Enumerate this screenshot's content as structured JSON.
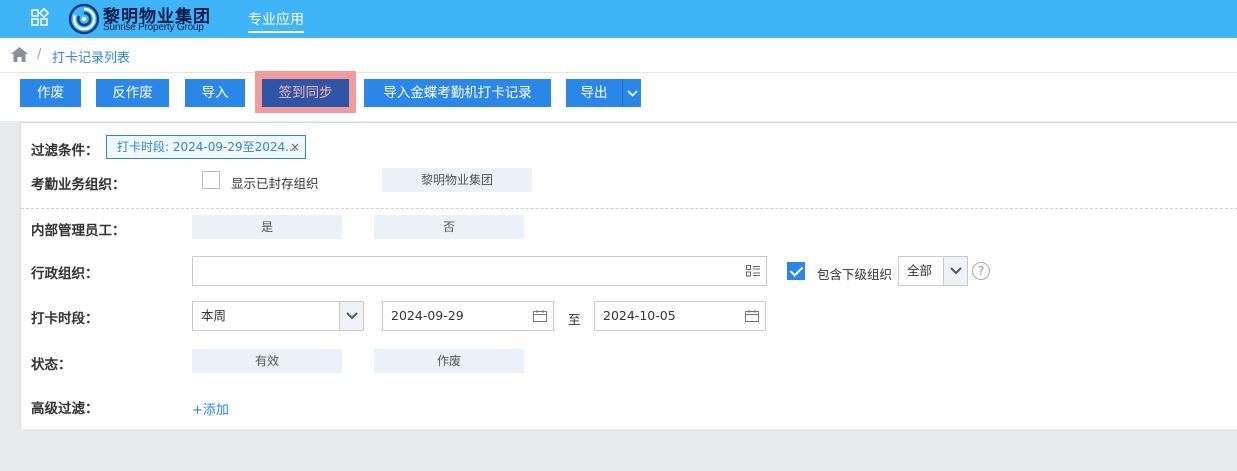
{
  "header": {
    "brand_cn": "黎明物业集团",
    "brand_en": "Sunrise Property Group",
    "nav_app": "专业应用",
    "accent": "#3fb4f7"
  },
  "breadcrumb": {
    "separator": "/",
    "current": "打卡记录列表"
  },
  "toolbar": {
    "void": "作废",
    "unvoid": "反作废",
    "import": "导入",
    "sync": "签到同步",
    "import_kingdee": "导入金蝶考勤机打卡记录",
    "export": "导出"
  },
  "filter": {
    "conditions_label": "过滤条件：",
    "active_tag": "打卡时段: 2024-09-29至2024...",
    "tag_close": "×",
    "org_label": "考勤业务组织：",
    "show_sealed": "显示已封存组织",
    "org_value": "黎明物业集团",
    "internal_label": "内部管理员工：",
    "internal_yes": "是",
    "internal_no": "否",
    "admin_org_label": "行政组织：",
    "admin_org_value": "",
    "include_sub": "包含下级组织",
    "scope_value": "全部",
    "help": "?",
    "period_label": "打卡时段：",
    "period_value": "本周",
    "date_from": "2024-09-29",
    "date_to_sep": "至",
    "date_to": "2024-10-05",
    "status_label": "状态：",
    "status_valid": "有效",
    "status_void": "作废",
    "advanced_label": "高级过滤：",
    "add": "+添加"
  }
}
